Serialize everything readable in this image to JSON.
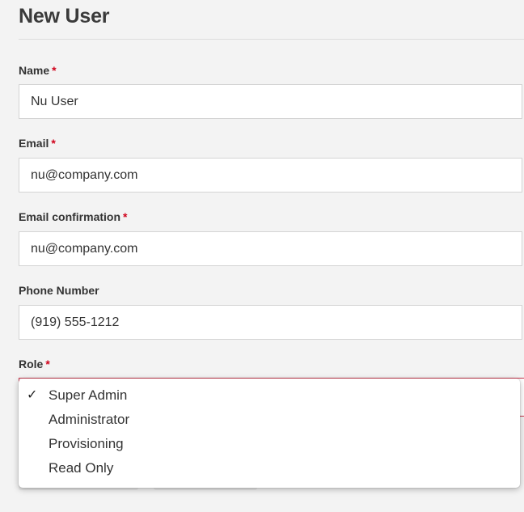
{
  "page": {
    "title": "New User"
  },
  "form": {
    "required_mark": "*",
    "name": {
      "label": "Name",
      "value": "Nu User"
    },
    "email": {
      "label": "Email",
      "value": "nu@company.com"
    },
    "email_confirmation": {
      "label": "Email confirmation",
      "value": "nu@company.com"
    },
    "phone": {
      "label": "Phone Number",
      "value": "(919) 555-1212"
    },
    "role": {
      "label": "Role",
      "selected": "Super Admin",
      "check_glyph": "✓",
      "options": [
        "Super Admin",
        "Administrator",
        "Provisioning",
        "Read Only"
      ]
    }
  },
  "colors": {
    "required": "#d0021b",
    "select_border": "#c7354b"
  }
}
